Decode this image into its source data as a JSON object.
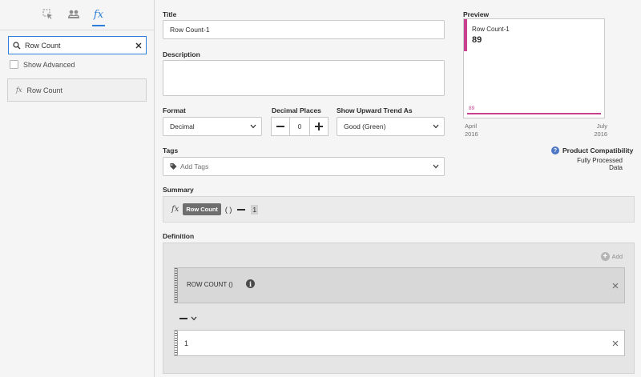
{
  "left_panel": {
    "tabs": [
      {
        "icon": "components-cursor-icon"
      },
      {
        "icon": "segments-people-icon"
      },
      {
        "icon": "fx-icon",
        "label": "fx",
        "active": true
      }
    ],
    "search": {
      "value": "Row Count",
      "icon": "search-icon"
    },
    "show_advanced": {
      "label": "Show Advanced",
      "checked": false
    },
    "results": [
      {
        "prefix": "fx",
        "label": "Row Count"
      }
    ]
  },
  "form": {
    "title_label": "Title",
    "title_value": "Row Count-1",
    "description_label": "Description",
    "description_value": "",
    "format_label": "Format",
    "format_value": "Decimal",
    "decimal_label": "Decimal Places",
    "decimal_value": "0",
    "trend_label": "Show Upward Trend As",
    "trend_value": "Good (Green)",
    "tags_label": "Tags",
    "tags_placeholder": "Add Tags"
  },
  "preview": {
    "label": "Preview",
    "metric_title": "Row Count-1",
    "metric_value": "89",
    "line_value": "89",
    "start_month": "April",
    "start_year": "2016",
    "end_month": "July",
    "end_year": "2016",
    "accent_color": "#c9408f"
  },
  "compatibility": {
    "title": "Product Compatibility",
    "subtitle": "Fully Processed Data"
  },
  "summary": {
    "label": "Summary",
    "fx": "fx",
    "chip": "Row Count",
    "parens": "( )",
    "constant": "1"
  },
  "definition": {
    "label": "Definition",
    "add_label": "Add",
    "function_label": "ROW COUNT ()",
    "constant_value": "1"
  }
}
